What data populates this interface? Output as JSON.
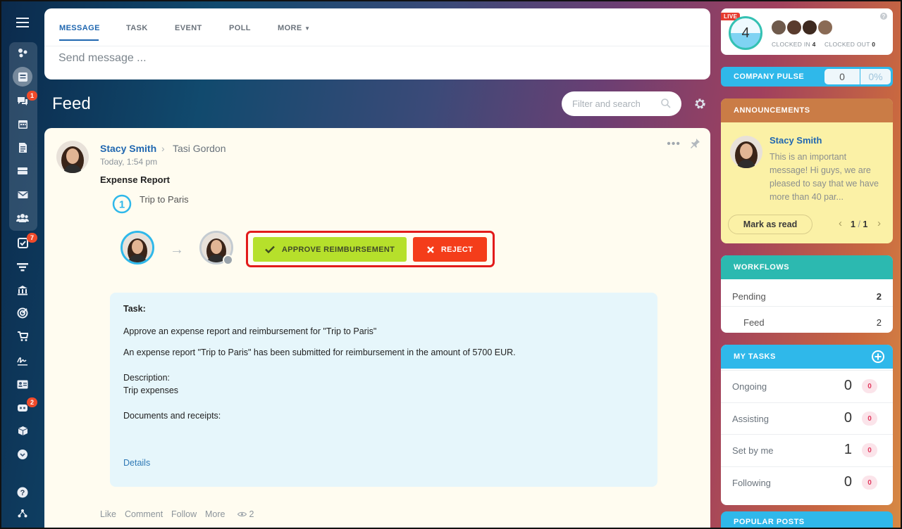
{
  "composer": {
    "tabs": [
      "MESSAGE",
      "TASK",
      "EVENT",
      "POLL",
      "MORE"
    ],
    "placeholder": "Send message ..."
  },
  "feed": {
    "title": "Feed",
    "search_placeholder": "Filter and search"
  },
  "nav": {
    "badges": {
      "chat": "1",
      "tasks": "7",
      "robots": "2"
    }
  },
  "post": {
    "author": "Stacy Smith",
    "recipient": "Tasi Gordon",
    "time": "Today, 1:54 pm",
    "title": "Expense Report",
    "step_label": "Trip to Paris",
    "approve_label": "APPROVE REIMBURSEMENT",
    "reject_label": "REJECT",
    "task": {
      "heading": "Task:",
      "line1": "Approve an expense report and reimbursement for \"Trip to Paris\"",
      "line2": "An expense report \"Trip to Paris\" has been submitted for reimbursement in the amount of 5700 EUR.",
      "description_label": "Description:",
      "description": "Trip expenses",
      "documents_label": "Documents and receipts:",
      "details_link": "Details"
    },
    "footer": {
      "like": "Like",
      "comment": "Comment",
      "follow": "Follow",
      "more": "More",
      "views": "2"
    }
  },
  "timeman": {
    "live": "LIVE",
    "count": "4",
    "clocked_in_label": "CLOCKED IN",
    "clocked_in": "4",
    "clocked_out_label": "CLOCKED OUT",
    "clocked_out": "0"
  },
  "pulse": {
    "label": "COMPANY PULSE",
    "value": "0",
    "percent": "0%"
  },
  "announcements": {
    "title": "ANNOUNCEMENTS",
    "author": "Stacy Smith",
    "text": "This is an important message! Hi guys, we are pleased to say that we have more than 40 par...",
    "mark_read": "Mark as read",
    "page": "1",
    "pages": "1"
  },
  "workflows": {
    "title": "WORKFLOWS",
    "rows": [
      {
        "label": "Pending",
        "value": "2"
      },
      {
        "label": "Feed",
        "value": "2"
      }
    ]
  },
  "my_tasks": {
    "title": "MY TASKS",
    "rows": [
      {
        "label": "Ongoing",
        "value": "0",
        "counter": "0"
      },
      {
        "label": "Assisting",
        "value": "0",
        "counter": "0"
      },
      {
        "label": "Set by me",
        "value": "1",
        "counter": "0"
      },
      {
        "label": "Following",
        "value": "0",
        "counter": "0"
      }
    ]
  },
  "popular": {
    "title": "POPULAR POSTS"
  },
  "colors": {
    "accent_blue": "#2067b0",
    "approve": "#b6e02b",
    "reject": "#f43d1a",
    "highlight_frame": "#e21b1b",
    "task_bg": "#e6f6fb",
    "announcement_bg": "#fbf1a6"
  }
}
